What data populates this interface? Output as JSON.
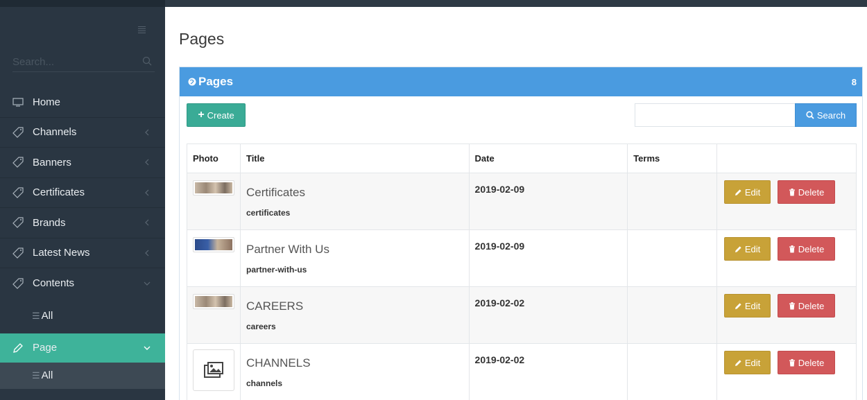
{
  "sidebar": {
    "search_placeholder": "Search...",
    "items": [
      {
        "label": "Home",
        "icon": "monitor-icon"
      },
      {
        "label": "Channels",
        "icon": "tag-icon"
      },
      {
        "label": "Banners",
        "icon": "tag-icon"
      },
      {
        "label": "Certificates",
        "icon": "tag-icon"
      },
      {
        "label": "Brands",
        "icon": "tag-icon"
      },
      {
        "label": "Latest News",
        "icon": "tag-icon"
      },
      {
        "label": "Contents",
        "icon": "tag-icon"
      }
    ],
    "contents_sub": {
      "label": "All"
    },
    "page_item": {
      "label": "Page",
      "icon": "pencil-icon"
    },
    "page_sub": {
      "label": "All"
    }
  },
  "main": {
    "title": "Pages",
    "panel": {
      "heading": "Pages",
      "count": "8"
    },
    "create_label": "Create",
    "search_value": "",
    "search_label": "Search",
    "columns": [
      "Photo",
      "Title",
      "Date",
      "Terms",
      ""
    ],
    "rows": [
      {
        "title": "Certificates",
        "slug": "certificates",
        "date": "2019-02-09",
        "terms": "",
        "photo": "thumbnail"
      },
      {
        "title": "Partner With Us",
        "slug": "partner-with-us",
        "date": "2019-02-09",
        "terms": "",
        "photo": "thumbnail"
      },
      {
        "title": "CAREERS",
        "slug": "careers",
        "date": "2019-02-02",
        "terms": "",
        "photo": "thumbnail"
      },
      {
        "title": "CHANNELS",
        "slug": "channels",
        "date": "2019-02-02",
        "terms": "",
        "photo": "placeholder-image-icon"
      }
    ],
    "edit_label": "Edit",
    "delete_label": "Delete"
  },
  "colors": {
    "sidebar_bg": "#2a3642",
    "accent_teal": "#3eb39a",
    "panel_blue": "#4a9be0",
    "edit_yellow": "#c8a238",
    "delete_red": "#d2585a"
  }
}
